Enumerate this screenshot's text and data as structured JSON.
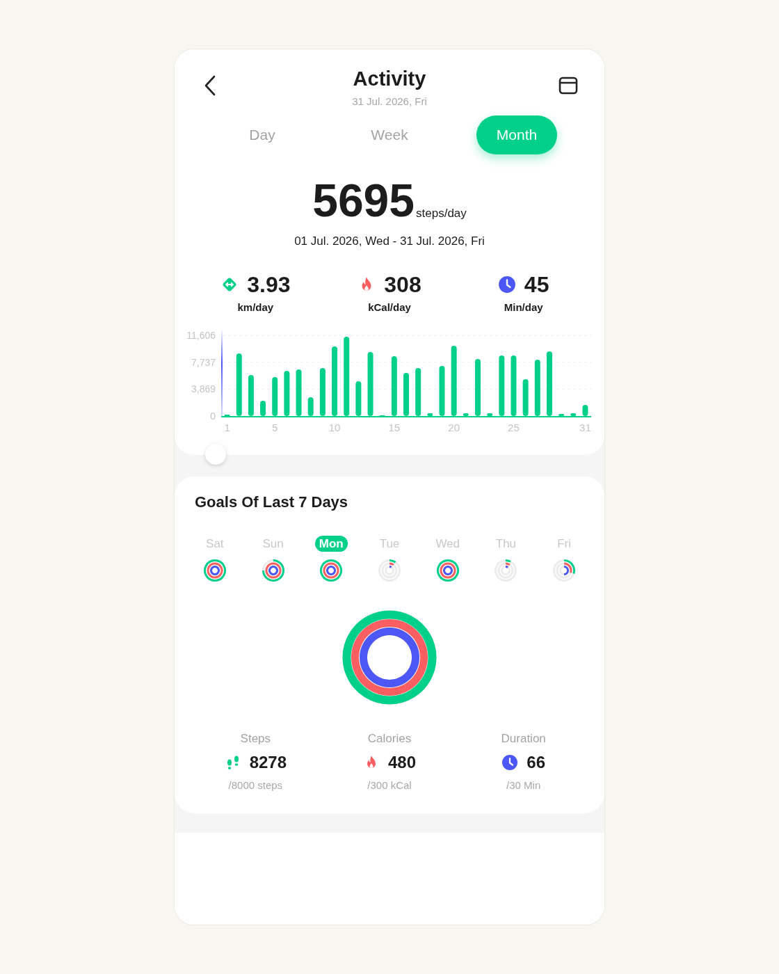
{
  "header": {
    "title": "Activity",
    "date": "31 Jul. 2026, Fri"
  },
  "tabs": [
    {
      "label": "Day",
      "selected": false
    },
    {
      "label": "Week",
      "selected": false
    },
    {
      "label": "Month",
      "selected": true
    }
  ],
  "summary": {
    "value": "5695",
    "unit": "steps/day",
    "range": "01 Jul. 2026, Wed - 31 Jul. 2026, Fri"
  },
  "stats": [
    {
      "kind": "distance",
      "value": "3.93",
      "unit": "km/day"
    },
    {
      "kind": "calories",
      "value": "308",
      "unit": "kCal/day"
    },
    {
      "kind": "duration",
      "value": "45",
      "unit": "Min/day"
    }
  ],
  "chart_data": {
    "type": "bar",
    "x": [
      1,
      2,
      3,
      4,
      5,
      6,
      7,
      8,
      9,
      10,
      11,
      12,
      13,
      14,
      15,
      16,
      17,
      18,
      19,
      20,
      21,
      22,
      23,
      24,
      25,
      26,
      27,
      28,
      29,
      30,
      31
    ],
    "xlim": [
      0.5,
      31.5
    ],
    "series": [
      {
        "color": "#00d08a",
        "values": [
          200,
          9000,
          5900,
          2200,
          5600,
          6500,
          6700,
          2700,
          6900,
          10000,
          11400,
          5000,
          9200,
          100,
          8600,
          6200,
          6900,
          400,
          7200,
          10100,
          400,
          8200,
          400,
          8700,
          8700,
          5300,
          8100,
          9300,
          300,
          400,
          1600
        ]
      }
    ],
    "ylim": [
      0,
      11606
    ],
    "yticks": [
      {
        "value": 0,
        "label": "0"
      },
      {
        "value": 3869,
        "label": "3,869"
      },
      {
        "value": 7737,
        "label": "7,737"
      },
      {
        "value": 11606,
        "label": "11,606"
      }
    ],
    "xticks": [
      1,
      5,
      10,
      15,
      20,
      25,
      31
    ]
  },
  "goals": {
    "title": "Goals Of Last 7 Days",
    "days": [
      {
        "label": "Sat",
        "selected": false
      },
      {
        "label": "Sun",
        "selected": false
      },
      {
        "label": "Mon",
        "selected": true
      },
      {
        "label": "Tue",
        "selected": false
      },
      {
        "label": "Wed",
        "selected": false
      },
      {
        "label": "Thu",
        "selected": false
      },
      {
        "label": "Fri",
        "selected": false
      }
    ],
    "totals": [
      {
        "kind": "steps",
        "label": "Steps",
        "value": "8278",
        "target": "/8000 steps"
      },
      {
        "kind": "calories",
        "label": "Calories",
        "value": "480",
        "target": "/300 kCal"
      },
      {
        "kind": "duration",
        "label": "Duration",
        "value": "66",
        "target": "/30 Min"
      }
    ]
  }
}
